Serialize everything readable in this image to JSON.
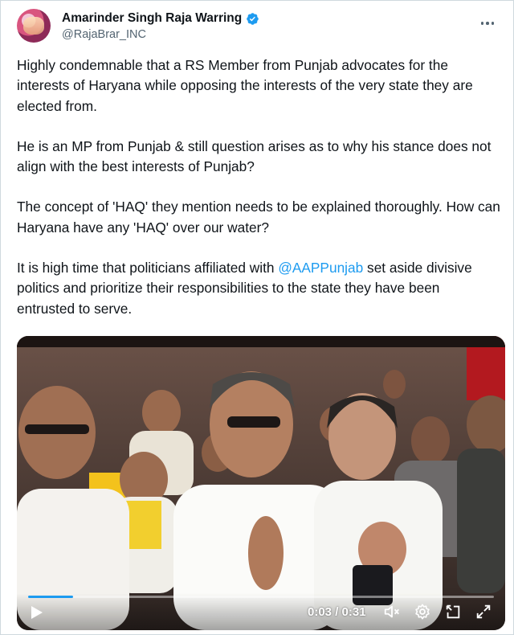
{
  "author": {
    "display_name": "Amarinder Singh Raja Warring",
    "handle": "@RajaBrar_INC",
    "verified": true
  },
  "tweet": {
    "paragraphs": [
      "Highly condemnable that a RS Member from Punjab advocates for the interests of Haryana while opposing the interests of the very state they are elected from.",
      "He is an MP from Punjab & still question arises as to why his  stance does not align with the best interests of Punjab?",
      "The concept of 'HAQ' they mention needs to be explained thoroughly. How can Haryana have any 'HAQ' over our water?"
    ],
    "last_paragraph": {
      "before": "It is high time that politicians affiliated with ",
      "mention": "@AAPPunjab",
      "after": " set aside divisive politics and prioritize their responsibilities to the state they have been entrusted to serve."
    }
  },
  "video": {
    "current_time": "0:03",
    "separator": " / ",
    "duration": "0:31",
    "progress_fraction": 0.097,
    "icons": [
      "play-icon",
      "mute-icon",
      "settings-icon",
      "picture-in-picture-icon",
      "fullscreen-icon"
    ]
  },
  "colors": {
    "accent": "#1d9bf0",
    "text": "#0f1419",
    "secondary_text": "#536471"
  }
}
